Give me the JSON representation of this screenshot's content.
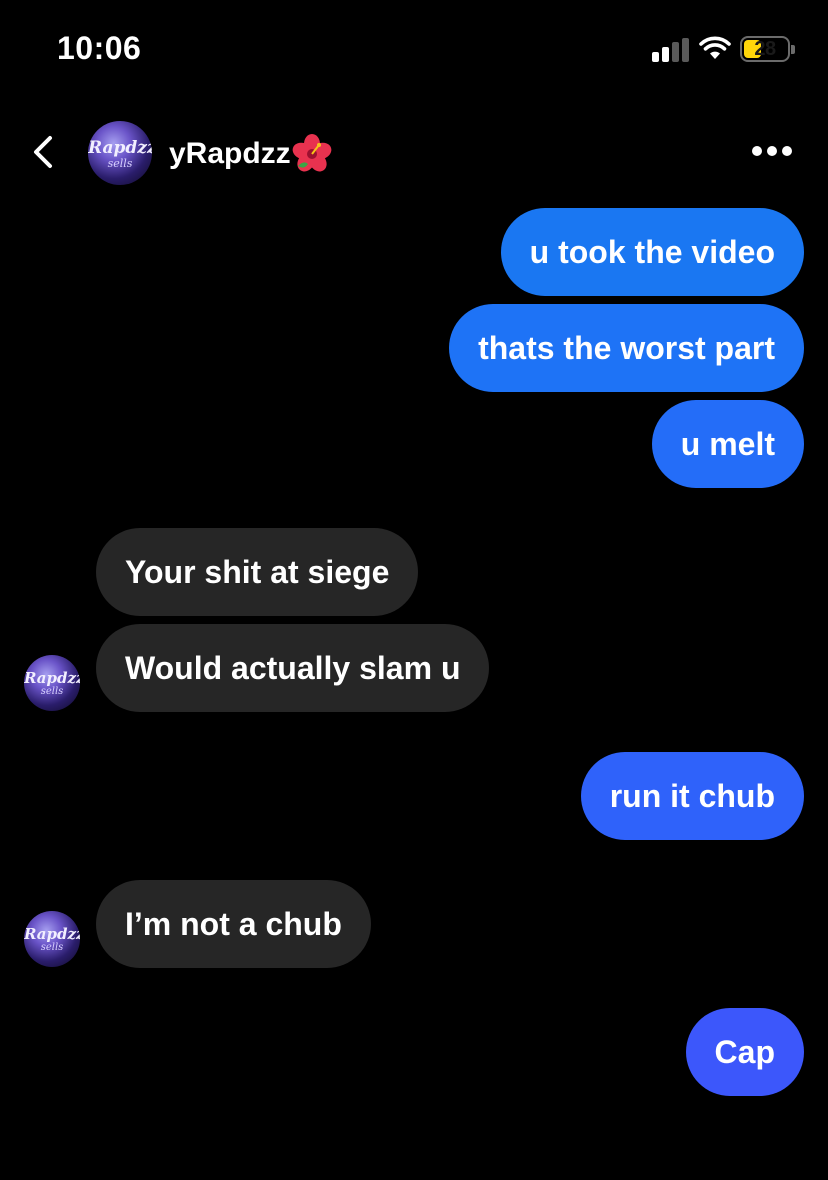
{
  "status_bar": {
    "time": "10:06",
    "battery_level": "28",
    "battery_color": "#ffd60a"
  },
  "header": {
    "username": "yRapdzz",
    "avatar_text": "Rapdzz",
    "avatar_subtext": "sells",
    "back_icon": "chevron-left-icon",
    "more_icon": "more-horizontal-icon",
    "emoji_icon": "hibiscus-icon"
  },
  "messages": [
    {
      "sender": "me",
      "text": "u took the video",
      "color": "#1a77f2"
    },
    {
      "sender": "me",
      "text": "thats the worst part",
      "color": "#1e73f6"
    },
    {
      "sender": "me",
      "text": "u melt",
      "color": "#246df8"
    },
    {
      "sender": "them",
      "text": "Your shit at siege"
    },
    {
      "sender": "them",
      "text": "Would actually slam u"
    },
    {
      "sender": "me",
      "text": "run it chub",
      "color": "#2f62fa"
    },
    {
      "sender": "them",
      "text": "I’m not a chub"
    },
    {
      "sender": "me",
      "text": "Cap",
      "color": "#3c57fb"
    }
  ],
  "colors": {
    "background": "#000000",
    "incoming_bubble": "#262626"
  }
}
